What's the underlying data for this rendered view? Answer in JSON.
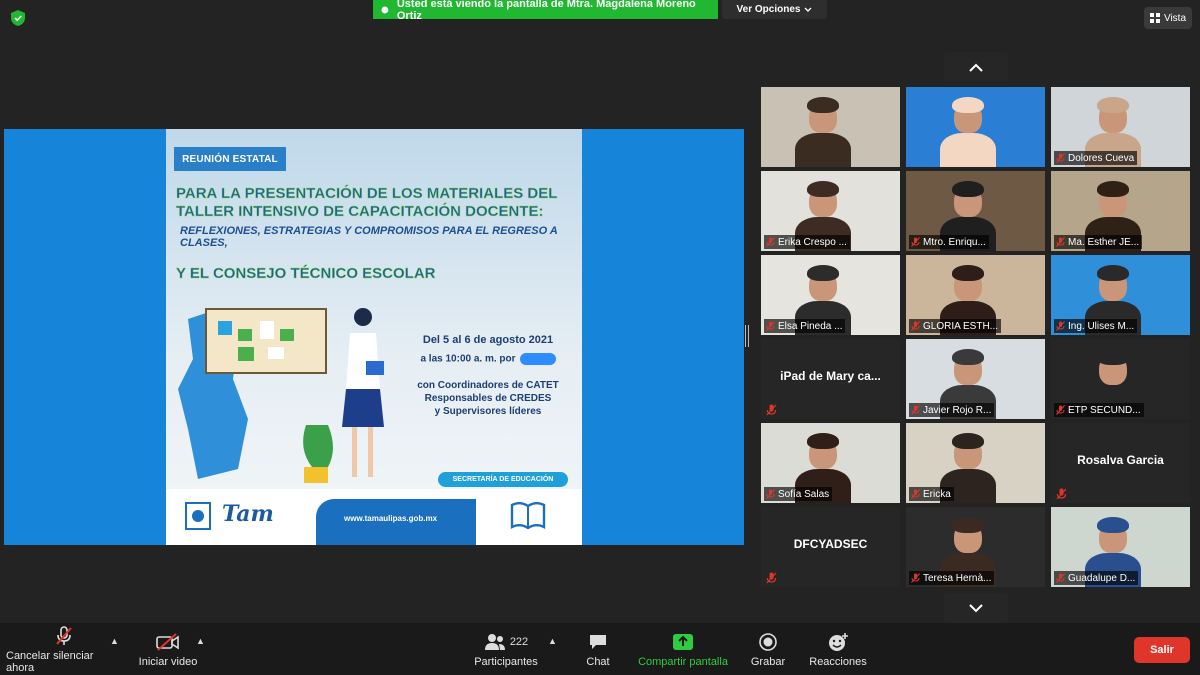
{
  "top_bar": {
    "share_banner": "Usted está viendo la pantalla de Mtra. Magdalena Moreno Ortiz",
    "view_options_label": "Ver Opciones",
    "view_label": "Vista"
  },
  "shared_screen": {
    "badge": "REUNIÓN ESTATAL",
    "title_line1": "PARA LA PRESENTACIÓN DE LOS MATERIALES DEL",
    "title_line2": "TALLER INTENSIVO DE CAPACITACIÓN DOCENTE:",
    "subtitle": "REFLEXIONES, ESTRATEGIAS Y COMPROMISOS PARA EL REGRESO A CLASES,",
    "title_line3": "Y EL CONSEJO TÉCNICO ESCOLAR",
    "date": "Del 5 al 6 de agosto 2021",
    "time": "a las 10:00 a. m. por",
    "with_line1": "con Coordinadores de CATET",
    "with_line2": "Responsables de CREDES",
    "with_line3": "y Supervisores líderes",
    "secretaria": "SECRETARÍA DE EDUCACIÓN",
    "url": "www.tamaulipas.gob.mx",
    "logo_text": "Tam"
  },
  "participants": [
    {
      "name": "",
      "muted": false,
      "video": true
    },
    {
      "name": "",
      "muted": false,
      "video": true
    },
    {
      "name": "Dolores Cueva",
      "muted": true,
      "video": true
    },
    {
      "name": "Erika Crespo ...",
      "muted": true,
      "video": true
    },
    {
      "name": "Mtro. Enriqu...",
      "muted": true,
      "video": true
    },
    {
      "name": "Ma. Esther JE...",
      "muted": true,
      "video": true
    },
    {
      "name": "Elsa Pineda ...",
      "muted": true,
      "video": true
    },
    {
      "name": "GLORIA ESTH...",
      "muted": true,
      "video": true
    },
    {
      "name": "Ing. Ulises M...",
      "muted": true,
      "video": true
    },
    {
      "name": "iPad de Mary ca...",
      "muted": true,
      "video": false
    },
    {
      "name": "Javier Rojo R...",
      "muted": true,
      "video": true
    },
    {
      "name": "ETP SECUND...",
      "muted": true,
      "video": true
    },
    {
      "name": "Sofía Salas",
      "muted": true,
      "video": true
    },
    {
      "name": "Ericka",
      "muted": true,
      "video": true
    },
    {
      "name": "Rosalva Garcia",
      "muted": true,
      "video": false
    },
    {
      "name": "DFCYADSEC",
      "muted": true,
      "video": false
    },
    {
      "name": "Teresa Hernà...",
      "muted": true,
      "video": true
    },
    {
      "name": "Guadalupe D...",
      "muted": true,
      "video": true
    }
  ],
  "toolbar": {
    "unmute_label": "Cancelar silenciar ahora",
    "video_label": "Iniciar video",
    "participants_label": "Participantes",
    "participants_count": "222",
    "chat_label": "Chat",
    "share_label": "Compartir pantalla",
    "record_label": "Grabar",
    "reactions_label": "Reacciones",
    "exit_label": "Salir"
  },
  "colors": {
    "background": "#232323",
    "share_banner": "#1fb830",
    "exit": "#e0352b",
    "share_button": "#2ecc40",
    "muted_icon": "#e0352b",
    "slide_blue": "#1684d8"
  }
}
